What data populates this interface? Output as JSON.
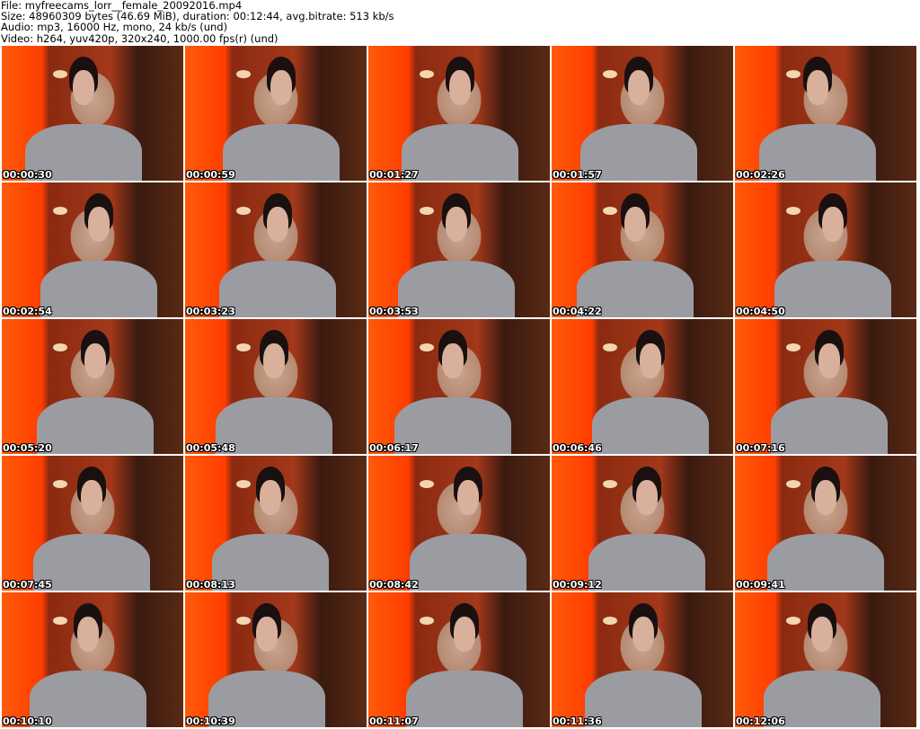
{
  "header": {
    "file": "File: myfreecams_lorr__female_20092016.mp4",
    "size": "Size: 48960309 bytes (46.69 MiB), duration: 00:12:44, avg.bitrate: 513 kb/s",
    "audio": "Audio: mp3, 16000 Hz, mono, 24 kb/s (und)",
    "video": "Video: h264, yuv420p, 320x240, 1000.00 fps(r) (und)"
  },
  "timestamps": [
    "00:00:30",
    "00:00:59",
    "00:01:27",
    "00:01:57",
    "00:02:26",
    "00:02:54",
    "00:03:23",
    "00:03:53",
    "00:04:22",
    "00:04:50",
    "00:05:20",
    "00:05:48",
    "00:06:17",
    "00:06:46",
    "00:07:16",
    "00:07:45",
    "00:08:13",
    "00:08:42",
    "00:09:12",
    "00:09:41",
    "00:10:10",
    "00:10:39",
    "00:11:07",
    "00:11:36",
    "00:12:06"
  ]
}
